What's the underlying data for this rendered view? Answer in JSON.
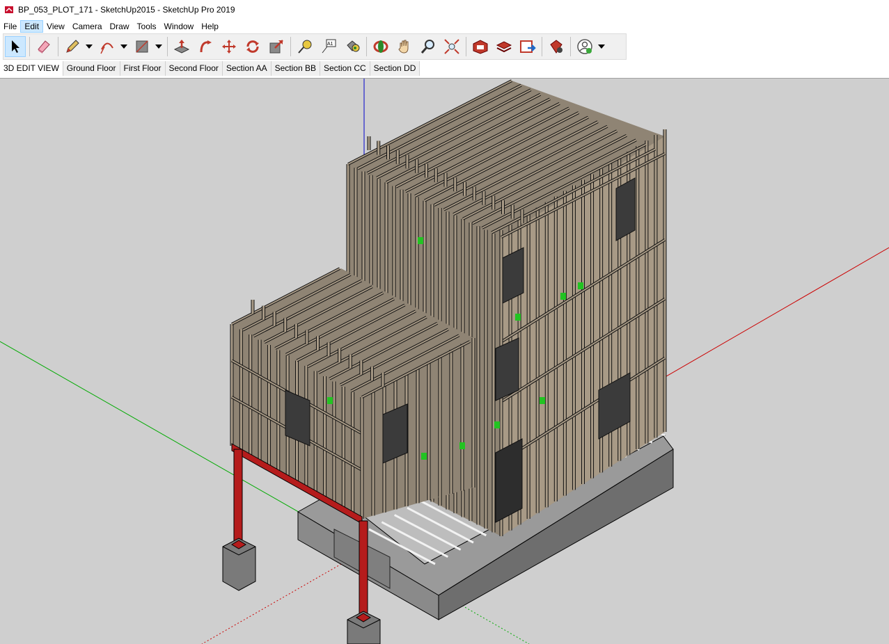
{
  "window": {
    "title": "BP_053_PLOT_171 - SketchUp2015 - SketchUp Pro 2019"
  },
  "menu": [
    "File",
    "Edit",
    "View",
    "Camera",
    "Draw",
    "Tools",
    "Window",
    "Help"
  ],
  "toolbar": {
    "tools": [
      "select-icon",
      "eraser-icon",
      "pencil-icon",
      "arc-icon",
      "rectangle-icon",
      "push-pull-icon",
      "follow-me-icon",
      "move-icon",
      "rotate-icon",
      "scale-icon",
      "tape-measure-icon",
      "text-icon",
      "paint-bucket-icon",
      "orbit-icon",
      "pan-icon",
      "zoom-icon",
      "zoom-extents-icon",
      "3d-warehouse-icon",
      "extension-warehouse-icon",
      "send-to-layout-icon",
      "extension-manager-icon",
      "account-icon"
    ]
  },
  "scenes": [
    "3D EDIT VIEW",
    "Ground Floor",
    "First Floor",
    "Second Floor",
    "Section AA",
    "Section BB",
    "Section CC",
    "Section DD"
  ],
  "viewport": {
    "background": "#cfcfcf",
    "axis_colors": {
      "x": "#cc0000",
      "y": "#00aa00",
      "z": "#0000cc"
    },
    "model_colors": {
      "timber": "#a89a86",
      "foundation": "#7a7a7a",
      "steel": "#b51c1c",
      "insulation": "#22c422"
    }
  }
}
